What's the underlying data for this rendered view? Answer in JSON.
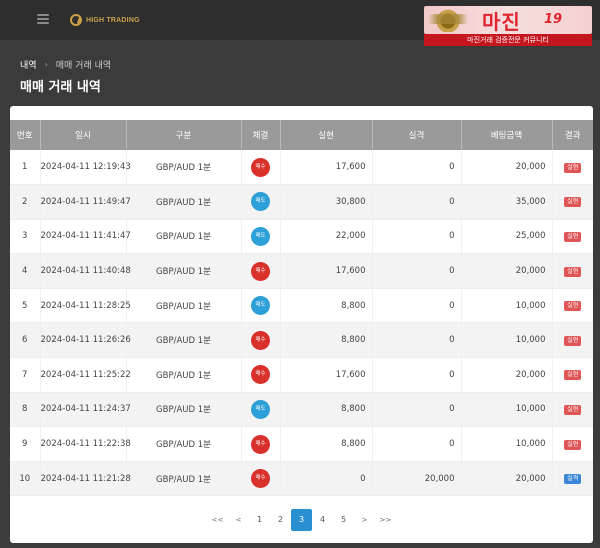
{
  "header": {
    "logo_text": "HIGH TRADING",
    "notification_count": "2"
  },
  "watermark": {
    "title": "마진",
    "tag": "19",
    "subtitle": "마진거래 검증전문 커뮤니티"
  },
  "breadcrumb": {
    "root": "내역",
    "separator": "›",
    "current": "매매 거래 내역"
  },
  "page_title": "매매 거래 내역",
  "table": {
    "columns": [
      "번호",
      "일시",
      "구분",
      "체결",
      "실현",
      "실격",
      "베팅금액",
      "결과"
    ],
    "rows": [
      {
        "no": "1",
        "datetime": "2024-04-11 12:19:43",
        "type": "GBP/AUD 1분",
        "side": "매수",
        "side_kind": "buy",
        "realized": "17,600",
        "lost": "0",
        "bet": "20,000",
        "result": "실현",
        "result_kind": "loss"
      },
      {
        "no": "2",
        "datetime": "2024-04-11 11:49:47",
        "type": "GBP/AUD 1분",
        "side": "매도",
        "side_kind": "sell",
        "realized": "30,800",
        "lost": "0",
        "bet": "35,000",
        "result": "실현",
        "result_kind": "loss"
      },
      {
        "no": "3",
        "datetime": "2024-04-11 11:41:47",
        "type": "GBP/AUD 1분",
        "side": "매도",
        "side_kind": "sell",
        "realized": "22,000",
        "lost": "0",
        "bet": "25,000",
        "result": "실현",
        "result_kind": "loss"
      },
      {
        "no": "4",
        "datetime": "2024-04-11 11:40:48",
        "type": "GBP/AUD 1분",
        "side": "매수",
        "side_kind": "buy",
        "realized": "17,600",
        "lost": "0",
        "bet": "20,000",
        "result": "실현",
        "result_kind": "loss"
      },
      {
        "no": "5",
        "datetime": "2024-04-11 11:28:25",
        "type": "GBP/AUD 1분",
        "side": "매도",
        "side_kind": "sell",
        "realized": "8,800",
        "lost": "0",
        "bet": "10,000",
        "result": "실현",
        "result_kind": "loss"
      },
      {
        "no": "6",
        "datetime": "2024-04-11 11:26:26",
        "type": "GBP/AUD 1분",
        "side": "매수",
        "side_kind": "buy",
        "realized": "8,800",
        "lost": "0",
        "bet": "10,000",
        "result": "실현",
        "result_kind": "loss"
      },
      {
        "no": "7",
        "datetime": "2024-04-11 11:25:22",
        "type": "GBP/AUD 1분",
        "side": "매수",
        "side_kind": "buy",
        "realized": "17,600",
        "lost": "0",
        "bet": "20,000",
        "result": "실현",
        "result_kind": "loss"
      },
      {
        "no": "8",
        "datetime": "2024-04-11 11:24:37",
        "type": "GBP/AUD 1분",
        "side": "매도",
        "side_kind": "sell",
        "realized": "8,800",
        "lost": "0",
        "bet": "10,000",
        "result": "실현",
        "result_kind": "loss"
      },
      {
        "no": "9",
        "datetime": "2024-04-11 11:22:38",
        "type": "GBP/AUD 1분",
        "side": "매수",
        "side_kind": "buy",
        "realized": "8,800",
        "lost": "0",
        "bet": "10,000",
        "result": "실현",
        "result_kind": "loss"
      },
      {
        "no": "10",
        "datetime": "2024-04-11 11:21:28",
        "type": "GBP/AUD 1분",
        "side": "매수",
        "side_kind": "buy",
        "realized": "0",
        "lost": "20,000",
        "bet": "20,000",
        "result": "실격",
        "result_kind": "win"
      }
    ]
  },
  "pagination": {
    "first": "<<",
    "prev": "<",
    "pages": [
      "1",
      "2",
      "3",
      "4",
      "5"
    ],
    "current": "3",
    "next": ">",
    "last": ">>"
  }
}
